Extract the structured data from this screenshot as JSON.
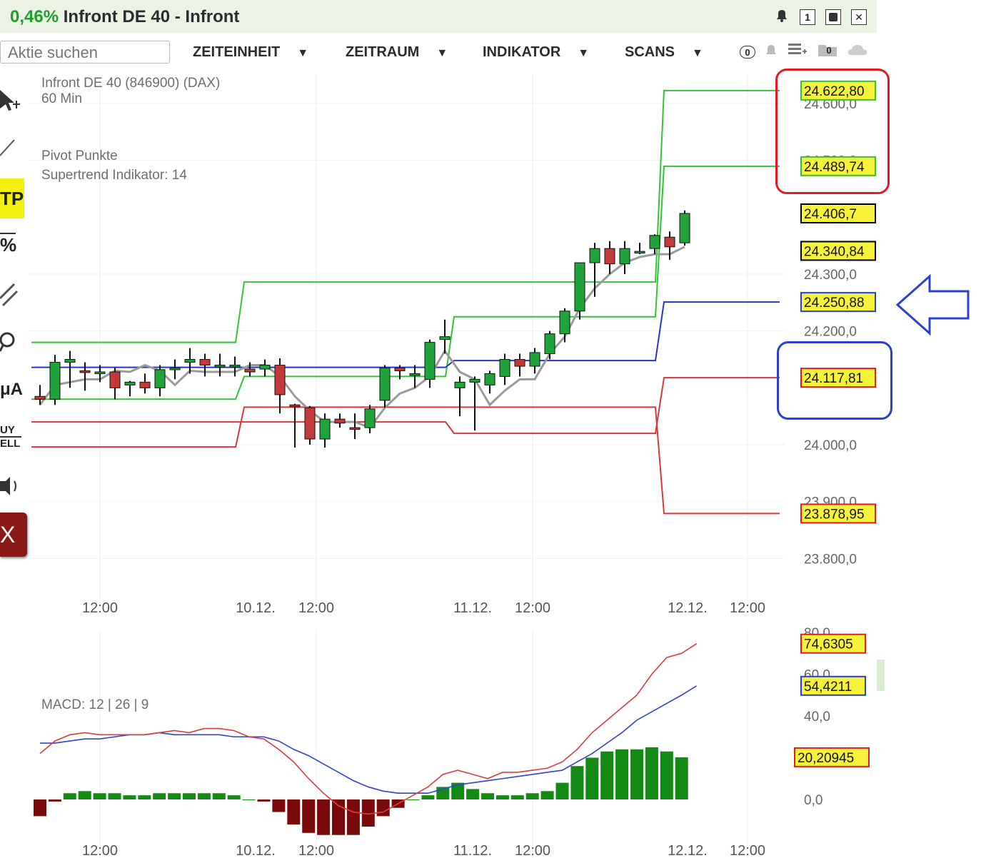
{
  "window": {
    "change_pct": "0,46%",
    "title": "Infront DE 40 - Infront"
  },
  "toolbar": {
    "search_placeholder": "Aktie suchen",
    "menus": [
      "ZEITEINHEIT",
      "ZEITRAUM",
      "INDIKATOR",
      "SCANS"
    ],
    "alarm_count": "0",
    "folder_count": "0"
  },
  "side_tools": {
    "tp": "TP",
    "pct": "%",
    "ma": "μA",
    "buy": "UY",
    "sell": "ELL",
    "close": "X"
  },
  "chart": {
    "instrument": "Infront DE 40 (846900) (DAX)",
    "interval": "60 Min",
    "indicators": [
      "Pivot Punkte",
      "Supertrend Indikator: 14"
    ],
    "macd_label": "MACD: 12 | 26 | 9"
  },
  "colors": {
    "up": "#1fa33a",
    "down": "#c23a3a",
    "resistance": "#34c23a",
    "pivot": "#2635c8",
    "support": "#d9363e",
    "supertrend": "#9a9a9a",
    "macd": "#e03b3b",
    "signal": "#2c44d4",
    "hist_up": "#138a13",
    "hist_down": "#7a0a0a"
  },
  "chart_data": [
    {
      "type": "candlestick",
      "title": "Infront DE 40 (846900) (DAX)",
      "interval": "60 Min",
      "y_ticks": [
        "24.600,0",
        "24.500,0",
        "24.300,0",
        "24.200,0",
        "24.000,0",
        "23.900,0",
        "23.800,0"
      ],
      "y_range": [
        23750,
        24650
      ],
      "x_labels": [
        "12:00",
        "10.12.",
        "12:00",
        "11.12.",
        "12:00",
        "12.12.",
        "12:00"
      ],
      "price_labels": [
        {
          "value": "24.622,80",
          "kind": "resistance"
        },
        {
          "value": "24.489,74",
          "kind": "resistance"
        },
        {
          "value": "24.406,7",
          "kind": "last"
        },
        {
          "value": "24.340,84",
          "kind": "supertrend"
        },
        {
          "value": "24.250,88",
          "kind": "pivot"
        },
        {
          "value": "24.117,81",
          "kind": "support"
        },
        {
          "value": "23.878,95",
          "kind": "support"
        }
      ],
      "candles": [
        {
          "i": 0,
          "o": 24085,
          "h": 24105,
          "l": 24070,
          "c": 24080
        },
        {
          "i": 1,
          "o": 24080,
          "h": 24158,
          "l": 24070,
          "c": 24145
        },
        {
          "i": 2,
          "o": 24145,
          "h": 24165,
          "l": 24100,
          "c": 24150
        },
        {
          "i": 3,
          "o": 24130,
          "h": 24145,
          "l": 24095,
          "c": 24128
        },
        {
          "i": 4,
          "o": 24128,
          "h": 24140,
          "l": 24110,
          "c": 24128
        },
        {
          "i": 5,
          "o": 24128,
          "h": 24135,
          "l": 24080,
          "c": 24100
        },
        {
          "i": 6,
          "o": 24105,
          "h": 24112,
          "l": 24085,
          "c": 24110
        },
        {
          "i": 7,
          "o": 24110,
          "h": 24125,
          "l": 24090,
          "c": 24100
        },
        {
          "i": 8,
          "o": 24100,
          "h": 24140,
          "l": 24085,
          "c": 24132
        },
        {
          "i": 9,
          "o": 24132,
          "h": 24150,
          "l": 24115,
          "c": 24135
        },
        {
          "i": 10,
          "o": 24145,
          "h": 24170,
          "l": 24125,
          "c": 24150
        },
        {
          "i": 11,
          "o": 24150,
          "h": 24160,
          "l": 24120,
          "c": 24140
        },
        {
          "i": 12,
          "o": 24140,
          "h": 24160,
          "l": 24120,
          "c": 24140
        },
        {
          "i": 13,
          "o": 24140,
          "h": 24155,
          "l": 24120,
          "c": 24140
        },
        {
          "i": 14,
          "o": 24133,
          "h": 24145,
          "l": 24120,
          "c": 24128
        },
        {
          "i": 15,
          "o": 24133,
          "h": 24150,
          "l": 24120,
          "c": 24140
        },
        {
          "i": 16,
          "o": 24140,
          "h": 24152,
          "l": 24055,
          "c": 24088
        },
        {
          "i": 17,
          "o": 24070,
          "h": 24072,
          "l": 23995,
          "c": 24068
        },
        {
          "i": 18,
          "o": 24065,
          "h": 24068,
          "l": 24000,
          "c": 24010
        },
        {
          "i": 19,
          "o": 24010,
          "h": 24055,
          "l": 23995,
          "c": 24045
        },
        {
          "i": 20,
          "o": 24045,
          "h": 24055,
          "l": 24030,
          "c": 24038
        },
        {
          "i": 21,
          "o": 24030,
          "h": 24055,
          "l": 24010,
          "c": 24028
        },
        {
          "i": 22,
          "o": 24030,
          "h": 24070,
          "l": 24020,
          "c": 24063
        },
        {
          "i": 23,
          "o": 24078,
          "h": 24140,
          "l": 24065,
          "c": 24135
        },
        {
          "i": 24,
          "o": 24135,
          "h": 24140,
          "l": 24115,
          "c": 24130
        },
        {
          "i": 25,
          "o": 24125,
          "h": 24140,
          "l": 24100,
          "c": 24125
        },
        {
          "i": 26,
          "o": 24115,
          "h": 24185,
          "l": 24100,
          "c": 24180
        },
        {
          "i": 27,
          "o": 24185,
          "h": 24220,
          "l": 24160,
          "c": 24190
        },
        {
          "i": 28,
          "o": 24100,
          "h": 24120,
          "l": 24050,
          "c": 24110
        },
        {
          "i": 29,
          "o": 24110,
          "h": 24120,
          "l": 24025,
          "c": 24115
        },
        {
          "i": 30,
          "o": 24105,
          "h": 24130,
          "l": 24090,
          "c": 24125
        },
        {
          "i": 31,
          "o": 24120,
          "h": 24160,
          "l": 24105,
          "c": 24150
        },
        {
          "i": 32,
          "o": 24150,
          "h": 24160,
          "l": 24120,
          "c": 24138
        },
        {
          "i": 33,
          "o": 24138,
          "h": 24170,
          "l": 24125,
          "c": 24162
        },
        {
          "i": 34,
          "o": 24160,
          "h": 24200,
          "l": 24150,
          "c": 24195
        },
        {
          "i": 35,
          "o": 24195,
          "h": 24240,
          "l": 24180,
          "c": 24235
        },
        {
          "i": 36,
          "o": 24235,
          "h": 24300,
          "l": 24220,
          "c": 24320
        },
        {
          "i": 37,
          "o": 24320,
          "h": 24355,
          "l": 24260,
          "c": 24345
        },
        {
          "i": 38,
          "o": 24345,
          "h": 24358,
          "l": 24300,
          "c": 24318
        },
        {
          "i": 39,
          "o": 24318,
          "h": 24358,
          "l": 24300,
          "c": 24345
        },
        {
          "i": 40,
          "o": 24340,
          "h": 24355,
          "l": 24335,
          "c": 24340
        },
        {
          "i": 41,
          "o": 24345,
          "h": 24370,
          "l": 24335,
          "c": 24368
        },
        {
          "i": 42,
          "o": 24365,
          "h": 24375,
          "l": 24325,
          "c": 24348
        },
        {
          "i": 43,
          "o": 24355,
          "h": 24412,
          "l": 24350,
          "c": 24406.7
        }
      ],
      "supertrend": [
        24070,
        24105,
        24110,
        24115,
        24115,
        24130,
        24128,
        24140,
        24130,
        24105,
        24130,
        24128,
        24128,
        24128,
        24140,
        24140,
        24120,
        24085,
        24060,
        24040,
        24040,
        24040,
        24030,
        24065,
        24090,
        24100,
        24120,
        24165,
        24128,
        24115,
        24070,
        24095,
        24115,
        24115,
        24160,
        24190,
        24240,
        24275,
        24300,
        24320,
        24330,
        24335,
        24335,
        24348
      ],
      "pivot_levels": {
        "segment_starts": [
          0,
          14,
          28,
          42,
          44
        ],
        "R2": [
          24180,
          24286,
          24286,
          24622.8
        ],
        "R1": [
          24080,
          24120,
          24225,
          24489.74
        ],
        "P": [
          24136,
          24136,
          24148,
          24250.88
        ],
        "S1": [
          24040,
          24040,
          24020,
          24117.81
        ],
        "S2": [
          23996,
          24066,
          24066,
          23878.95
        ]
      }
    },
    {
      "type": "macd",
      "title": "MACD: 12 | 26 | 9",
      "y_ticks": [
        "80,0",
        "60,0",
        "40,0",
        "0,0"
      ],
      "y_range": [
        -20,
        85
      ],
      "x_labels": [
        "12:00",
        "10.12.",
        "12:00",
        "11.12.",
        "12:00",
        "12.12.",
        "12:00"
      ],
      "value_labels": [
        {
          "value": "74,6305",
          "kind": "macd"
        },
        {
          "value": "54,4211",
          "kind": "signal"
        },
        {
          "value": "20,20945",
          "kind": "histogram"
        }
      ],
      "macd": [
        22,
        28,
        31,
        32,
        31,
        31,
        31,
        31,
        32,
        33,
        32,
        34,
        34,
        33,
        30,
        29,
        24,
        18,
        10,
        3,
        -3,
        -6,
        -7,
        -6,
        -2,
        2,
        6,
        12,
        14,
        12,
        10,
        13,
        13,
        14,
        15,
        18,
        24,
        32,
        38,
        44,
        50,
        60,
        68,
        70,
        74.63
      ],
      "signal": [
        27,
        27,
        28,
        29,
        29,
        30,
        31,
        31,
        32,
        31,
        31,
        31,
        31,
        30,
        30,
        30,
        28,
        24,
        21,
        17,
        13,
        9,
        6,
        4,
        3,
        3,
        3,
        5,
        7,
        8,
        9,
        10,
        11,
        12,
        13,
        14,
        18,
        22,
        27,
        32,
        38,
        42,
        46,
        50,
        54.42
      ],
      "histogram": [
        -8,
        -1,
        3,
        4,
        3,
        3,
        2,
        2,
        3,
        3,
        3,
        3,
        3,
        2,
        0,
        -1,
        -6,
        -12,
        -16,
        -17,
        -17,
        -17,
        -13,
        -8,
        -4,
        0,
        2,
        6,
        8,
        5,
        3,
        2,
        2,
        3,
        4,
        8,
        16,
        20,
        23,
        24,
        24,
        25,
        23,
        20.21
      ]
    }
  ]
}
